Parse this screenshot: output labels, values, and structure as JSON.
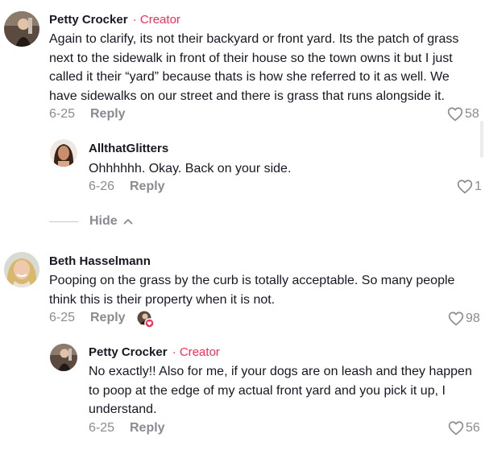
{
  "comments": [
    {
      "username": "Petty Crocker",
      "dot": "·",
      "badge": "Creator",
      "text": "Again to clarify, its not their backyard or front yard. Its the patch of grass next to the sidewalk in front of their house so the town owns it but I just called it their “yard” because thats is how she referred to it as well. We have sidewalks on our street and there is grass that runs alongside it.",
      "date": "6-25",
      "reply_label": "Reply",
      "likes": "58"
    },
    {
      "username": "AllthatGlitters",
      "text": "Ohhhhhh. Okay. Back on your side.",
      "date": "6-26",
      "reply_label": "Reply",
      "likes": "1"
    },
    {
      "username": "Beth Hasselmann",
      "text": "Pooping on the grass by the curb is totally acceptable. So many people think this is their property when it is not.",
      "date": "6-25",
      "reply_label": "Reply",
      "likes": "98"
    },
    {
      "username": "Petty Crocker",
      "dot": "·",
      "badge": "Creator",
      "text": "No exactly!! Also for me, if your dogs are on leash and they happen to poop at the edge of my actual front yard and you pick it up, I understand.",
      "date": "6-25",
      "reply_label": "Reply",
      "likes": "56"
    }
  ],
  "hide_label": "Hide",
  "icons": {
    "like": "heart-outline-icon",
    "hide": "chevron-up-icon",
    "creator_liked": "creator-liked-heart-icon"
  },
  "colors": {
    "accent": "#fe2c55",
    "text": "#161823",
    "muted": "#8a8b91"
  }
}
